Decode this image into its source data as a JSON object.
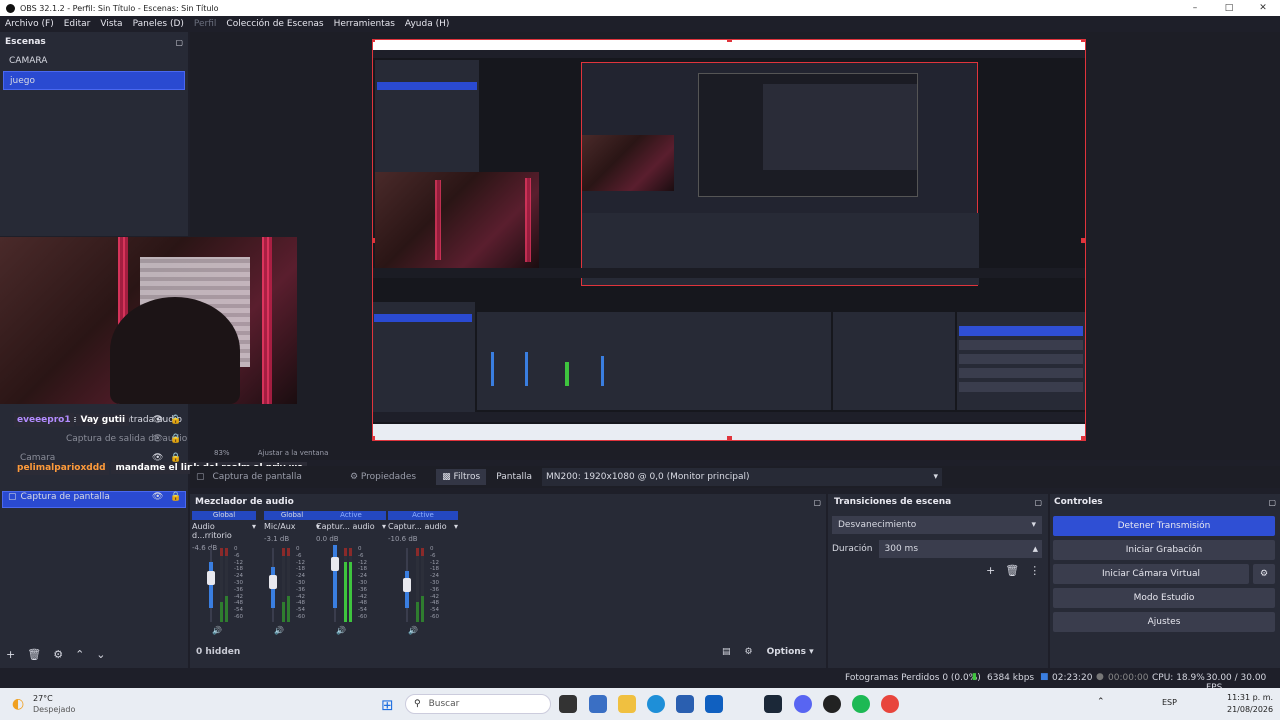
{
  "titlebar": {
    "title": "OBS 32.1.2 - Perfil: Sin Título - Escenas: Sin Título"
  },
  "menu": {
    "items": [
      "Archivo (F)",
      "Editar",
      "Vista",
      "Paneles (D)",
      "Perfil",
      "Colección de Escenas",
      "Herramientas",
      "Ayuda (H)"
    ]
  },
  "scenes": {
    "title": "Escenas",
    "items": [
      "CAMARA",
      "juego"
    ]
  },
  "sources": {
    "items": [
      {
        "label": "Captura de entrada audio"
      },
      {
        "label": "Captura de salida de audio"
      },
      {
        "label": "Camara"
      },
      {
        "label": "Captura de pantalla"
      }
    ]
  },
  "chat": [
    {
      "user": "eveeepro1",
      "user_color": "#b38cff",
      "message": "Vay gutii"
    },
    {
      "user": "pelimalparioxddd",
      "user_color": "#ff9b3a",
      "message": "mandame el link del realm al priv we"
    }
  ],
  "zoom_bar": {
    "zoom": "83%",
    "fit": "Ajustar a la ventana"
  },
  "prop_bar": {
    "source": "Captura de pantalla",
    "properties": "Propiedades",
    "filters": "Filtros",
    "screen_label": "Pantalla",
    "screen_value": "MN200: 1920x1080 @ 0,0 (Monitor principal)"
  },
  "mixer": {
    "title": "Mezclador de audio",
    "channels": [
      {
        "tag": "Global",
        "name": "Audio d...rritorio",
        "db": "-4.6 dB"
      },
      {
        "tag": "Global",
        "name": "Mic/Aux",
        "db": "-3.1 dB"
      },
      {
        "tag": "Active",
        "name": "Captur... audio",
        "db": "0.0 dB"
      },
      {
        "tag": "Active",
        "name": "Captur... audio",
        "db": "-10.6 dB"
      }
    ],
    "scale": [
      "0",
      "-6",
      "-12",
      "-18",
      "-24",
      "-30",
      "-36",
      "-42",
      "-48",
      "-54",
      "-60"
    ],
    "hidden": "0 hidden",
    "options": "Options"
  },
  "transitions": {
    "title": "Transiciones de escena",
    "type": "Desvanecimiento",
    "duration_label": "Duración",
    "duration": "300 ms"
  },
  "controls": {
    "title": "Controles",
    "buttons": [
      "Detener Transmisión",
      "Iniciar Grabación",
      "Iniciar Cámara Virtual",
      "Modo Estudio",
      "Ajustes"
    ]
  },
  "status": {
    "dropped": "Fotogramas Perdidos 0 (0.0%)",
    "bitrate": "6384 kbps",
    "stream_time": "02:23:20",
    "rec_time": "00:00:00",
    "cpu": "CPU: 18.9%",
    "fps": "30.00 / 30.00 FPS"
  },
  "taskbar": {
    "weather_temp": "27°C",
    "weather_desc": "Despejado",
    "search": "Buscar",
    "lang": "ESP",
    "time": "11:31 p. m.",
    "date": "21/08/2026"
  },
  "colors": {
    "accent": "#2f4fd4",
    "recording_red": "#e0343c"
  }
}
